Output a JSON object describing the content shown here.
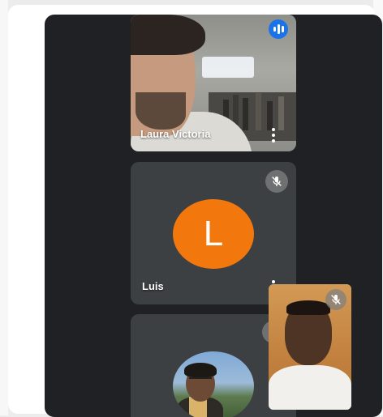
{
  "participants": [
    {
      "name": "Laura Victoria",
      "status": "speaking",
      "icon": "audio-wave-icon"
    },
    {
      "name": "Luis",
      "avatar_letter": "L",
      "status": "muted",
      "icon": "mic-off-icon",
      "avatar_color": "#f2780e"
    },
    {
      "name": "",
      "status": "muted",
      "icon": "mic-off-icon"
    }
  ],
  "self_view": {
    "status": "muted",
    "icon": "mic-off-icon"
  },
  "colors": {
    "background": "#202124",
    "tile": "#3c4043",
    "speaking_accent": "#1a73e8",
    "avatar_orange": "#f2780e"
  }
}
